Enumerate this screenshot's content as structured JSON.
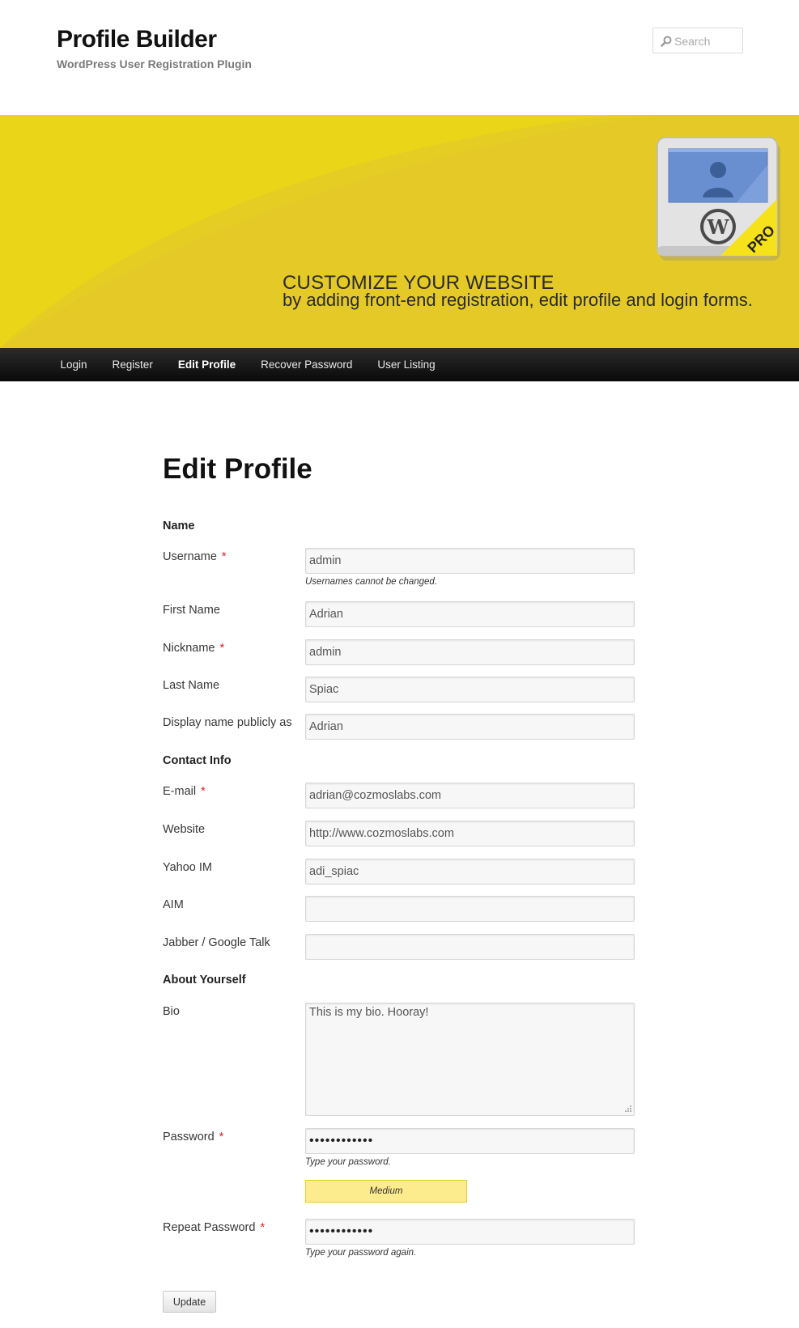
{
  "site": {
    "title": "Profile Builder",
    "description": "WordPress User Registration Plugin"
  },
  "search": {
    "placeholder": "Search",
    "icon": "search-icon"
  },
  "banner": {
    "headline": "CUSTOMIZE YOUR WEBSITE",
    "subline": "by adding front-end registration, edit profile and login forms.",
    "badge": "PRO",
    "colors": {
      "background": "#e9d31a",
      "accent": "#f3e21c"
    }
  },
  "nav": {
    "items": [
      {
        "label": "Login",
        "active": false
      },
      {
        "label": "Register",
        "active": false
      },
      {
        "label": "Edit Profile",
        "active": true
      },
      {
        "label": "Recover Password",
        "active": false
      },
      {
        "label": "User Listing",
        "active": false
      }
    ]
  },
  "page": {
    "title": "Edit Profile"
  },
  "form": {
    "sections": {
      "name": "Name",
      "contact": "Contact Info",
      "about": "About Yourself"
    },
    "required_mark": "*",
    "fields": {
      "username": {
        "label": "Username",
        "value": "admin",
        "hint": "Usernames cannot be changed."
      },
      "first_name": {
        "label": "First Name",
        "value": "Adrian"
      },
      "nickname": {
        "label": "Nickname",
        "value": "admin"
      },
      "last_name": {
        "label": "Last Name",
        "value": "Spiac"
      },
      "display_name": {
        "label": "Display name publicly as",
        "value": "Adrian"
      },
      "email": {
        "label": "E-mail",
        "value": "adrian@cozmoslabs.com"
      },
      "website": {
        "label": "Website",
        "value": "http://www.cozmoslabs.com"
      },
      "yahoo": {
        "label": "Yahoo IM",
        "value": "adi_spiac"
      },
      "aim": {
        "label": "AIM",
        "value": ""
      },
      "jabber": {
        "label": "Jabber / Google Talk",
        "value": ""
      },
      "bio": {
        "label": "Bio",
        "value": "This is my bio. Hooray!"
      },
      "password": {
        "label": "Password",
        "value": "••••••••••••",
        "hint": "Type your password."
      },
      "password_strength": "Medium",
      "repeat_password": {
        "label": "Repeat Password",
        "value": "••••••••••••",
        "hint": "Type your password again."
      }
    },
    "submit_label": "Update"
  }
}
